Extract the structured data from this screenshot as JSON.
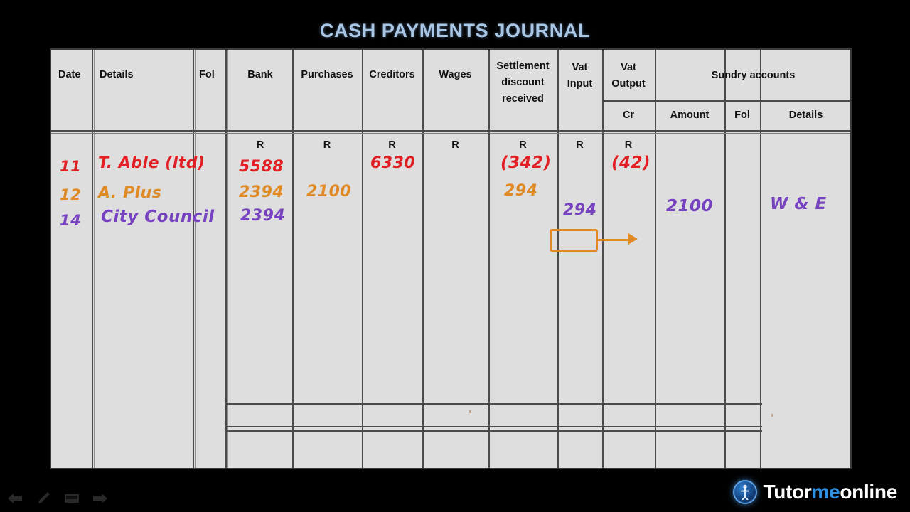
{
  "page": {
    "title": "CASH PAYMENTS JOURNAL",
    "title_color": "#a9c6e4",
    "background": "#000000",
    "sheet_color": "#dedede"
  },
  "journal": {
    "currency_symbol": "R",
    "headers": {
      "date": "Date",
      "details": "Details",
      "fol": "Fol",
      "bank": "Bank",
      "purchases": "Purchases",
      "creditors": "Creditors",
      "wages": "Wages",
      "settlement_discount_received": "Settlement discount received",
      "settlement_line_1": "Settlement",
      "settlement_line_2": "discount",
      "settlement_line_3": "received",
      "vat_input_line_1": "Vat",
      "vat_input_line_2": "Input",
      "vat_output_line_1": "Vat",
      "vat_output_line_2": "Output",
      "vat_output_sub": "Cr",
      "sundry_accounts": "Sundry accounts",
      "sundry_amount": "Amount",
      "sundry_fol": "Fol",
      "sundry_details": "Details"
    },
    "r_marks": [
      "R",
      "R",
      "R",
      "R",
      "R",
      "R",
      "R"
    ],
    "rows": [
      {
        "date": "11",
        "details": "T. Able (ltd)",
        "bank": "5588",
        "purchases": "",
        "creditors": "6330",
        "wages": "",
        "settlement_discount": "(342)",
        "vat_input": "",
        "vat_output": "(42)",
        "sundry_amount": "",
        "sundry_details": "",
        "color": "#e12025",
        "color_name": "red"
      },
      {
        "date": "12",
        "details": "A. Plus",
        "bank": "2394",
        "purchases": "2100",
        "creditors": "",
        "wages": "",
        "settlement_discount": "294",
        "vat_input": "",
        "vat_output": "",
        "sundry_amount": "",
        "sundry_details": "",
        "color": "#e08a26",
        "color_name": "orange"
      },
      {
        "date": "14",
        "details": "City Council",
        "bank": "2394",
        "purchases": "",
        "creditors": "",
        "wages": "",
        "settlement_discount": "",
        "vat_input": "294",
        "vat_output": "",
        "sundry_amount": "2100",
        "sundry_details": "W & E",
        "color": "#7742c0",
        "color_name": "purple"
      }
    ],
    "annotation": {
      "highlight_value": "294",
      "highlight_color": "#e08a26",
      "arrow_from": "settlement-discount-received",
      "arrow_to": "vat-input"
    }
  },
  "toolbar": {
    "items": [
      {
        "icon": "back-arrow-icon",
        "label": "Back"
      },
      {
        "icon": "pen-icon",
        "label": "Pen"
      },
      {
        "icon": "eraser-icon",
        "label": "Eraser"
      },
      {
        "icon": "forward-arrow-icon",
        "label": "Forward"
      }
    ]
  },
  "logo": {
    "text_1": "Tutor",
    "text_2": "me",
    "text_3": "online",
    "accent_color": "#2f8fe0"
  }
}
